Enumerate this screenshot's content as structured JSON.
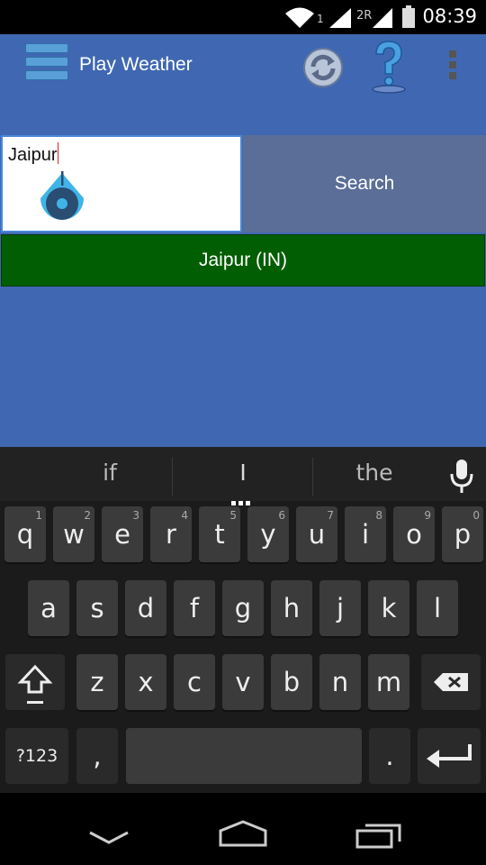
{
  "status_bar": {
    "time": "08:39",
    "sim1_label": "1",
    "sim2_label": "2R",
    "icons": [
      "wifi-icon",
      "signal-icon",
      "signal-roaming-icon",
      "battery-icon"
    ]
  },
  "action_bar": {
    "title": "Play Weather",
    "icons": [
      "menu-icon",
      "refresh-icon",
      "help-icon",
      "overflow-icon"
    ]
  },
  "search": {
    "input_value": "Jaipur",
    "button_label": "Search"
  },
  "results": [
    {
      "label": "Jaipur (IN)"
    }
  ],
  "keyboard": {
    "suggestions": [
      "if",
      "I",
      "the"
    ],
    "row1": [
      {
        "key": "q",
        "hint": "1"
      },
      {
        "key": "w",
        "hint": "2"
      },
      {
        "key": "e",
        "hint": "3"
      },
      {
        "key": "r",
        "hint": "4"
      },
      {
        "key": "t",
        "hint": "5"
      },
      {
        "key": "y",
        "hint": "6"
      },
      {
        "key": "u",
        "hint": "7"
      },
      {
        "key": "i",
        "hint": "8"
      },
      {
        "key": "o",
        "hint": "9"
      },
      {
        "key": "p",
        "hint": "0"
      }
    ],
    "row2": [
      "a",
      "s",
      "d",
      "f",
      "g",
      "h",
      "j",
      "k",
      "l"
    ],
    "row3": [
      "z",
      "x",
      "c",
      "v",
      "b",
      "n",
      "m"
    ],
    "symbols_label": "?123",
    "comma_label": ",",
    "period_label": "."
  },
  "colors": {
    "app_background": "#4068b2",
    "search_button": "#5a6e98",
    "result_row": "#025e02",
    "keyboard_background": "#1b1b1b"
  }
}
